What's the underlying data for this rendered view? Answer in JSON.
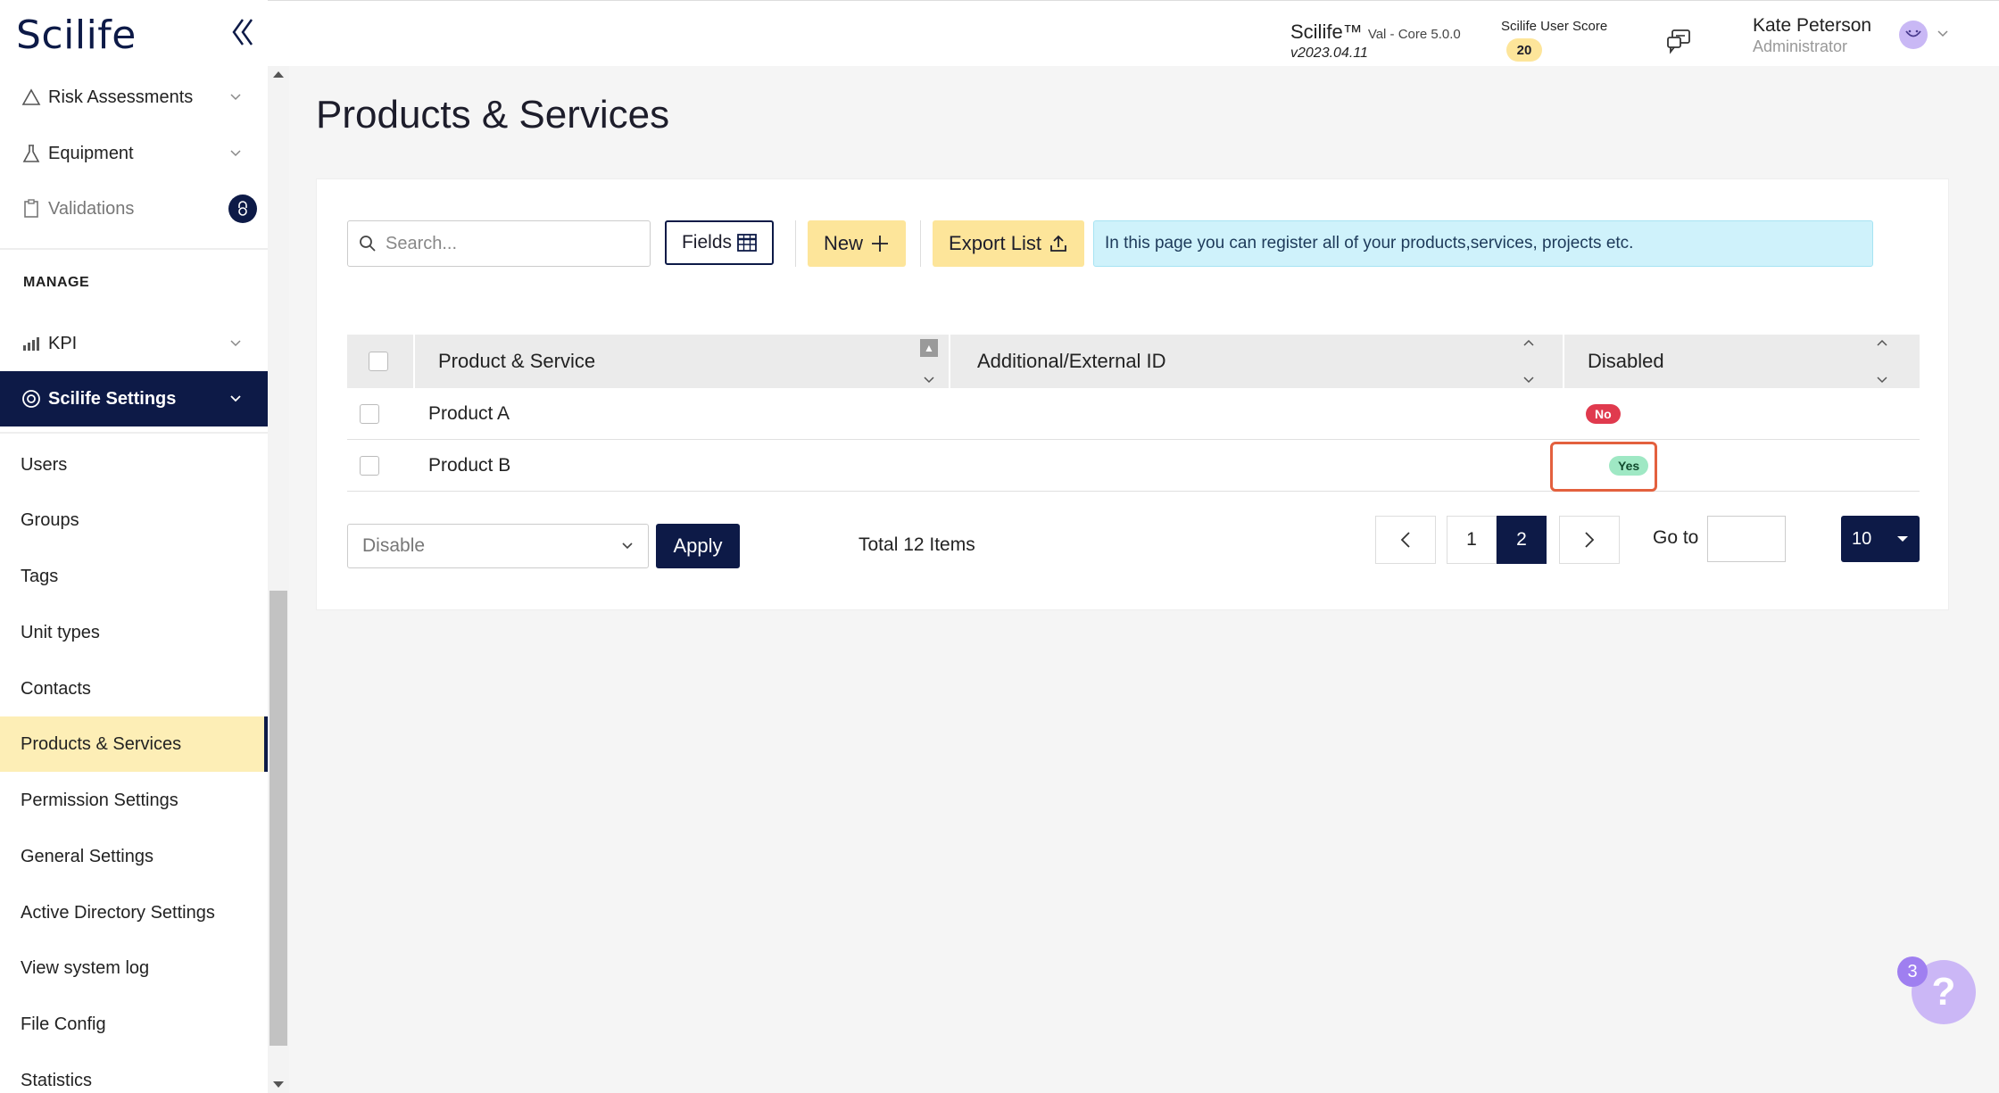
{
  "app": {
    "logo": "Scilife",
    "brand": "Scilife™",
    "brand_sub": "Val - Core 5.0.0",
    "version": "v2023.04.11",
    "score_label": "Scilife User Score",
    "score_value": "20",
    "user_name": "Kate Peterson",
    "user_role": "Administrator"
  },
  "sidebar": {
    "top_items": [
      {
        "label": "Risk Assessments",
        "icon": "warning-triangle-icon"
      },
      {
        "label": "Equipment",
        "icon": "flask-icon"
      },
      {
        "label": "Validations",
        "icon": "clipboard-icon",
        "locked": true
      }
    ],
    "section_title": "MANAGE",
    "kpi": {
      "label": "KPI",
      "icon": "bar-chart-icon"
    },
    "settings": {
      "label": "Scilife Settings",
      "icon": "gear-circle-icon"
    },
    "sub_items": [
      "Users",
      "Groups",
      "Tags",
      "Unit types",
      "Contacts",
      "Products & Services",
      "Permission Settings",
      "General Settings",
      "Active Directory Settings",
      "View system log",
      "File Config",
      "Statistics"
    ],
    "selected_sub_item": "Products & Services"
  },
  "page": {
    "title": "Products & Services"
  },
  "toolbar": {
    "search_placeholder": "Search...",
    "fields_label": "Fields",
    "new_label": "New",
    "export_label": "Export List",
    "info_text": "In this page you can register all of your products,services, projects etc."
  },
  "table": {
    "columns": [
      "Product & Service",
      "Additional/External ID",
      "Disabled"
    ],
    "rows": [
      {
        "name": "Product A",
        "external_id": "",
        "disabled": "No"
      },
      {
        "name": "Product B",
        "external_id": "",
        "disabled": "Yes"
      }
    ]
  },
  "footer": {
    "bulk_action": "Disable",
    "apply_label": "Apply",
    "total_text": "Total 12 Items",
    "pages": [
      "1",
      "2"
    ],
    "current_page": "2",
    "goto_label": "Go to",
    "per_page": "10"
  },
  "help": {
    "icon_text": "?",
    "count": "3"
  },
  "colors": {
    "navy": "#0d1a47",
    "yellow": "#fde59a",
    "selected_bg": "#fdeeb6",
    "info_bg": "#cff2fb",
    "pill_no": "#e03a4e",
    "pill_yes": "#9fe8c4",
    "highlight": "#e3603e"
  }
}
